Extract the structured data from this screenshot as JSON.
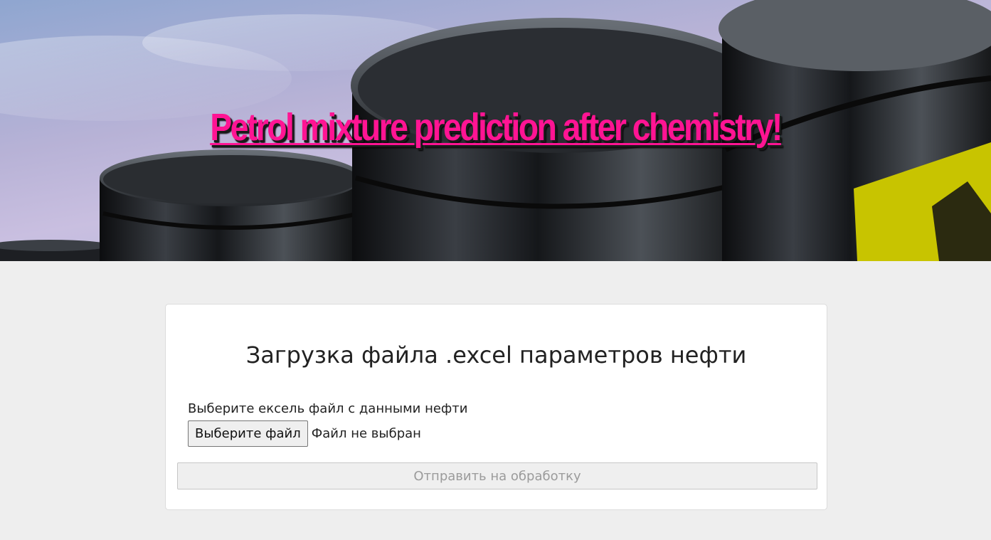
{
  "hero": {
    "title": "Petrol mixture prediction after chemistry!",
    "title_color": "#ff1493"
  },
  "upload": {
    "heading": "Загрузка файла .excel параметров нефти",
    "field_label": "Выберите ексель файл с данными нефти",
    "choose_button": "Выберите файл",
    "file_status": "Файл не выбран",
    "submit_button": "Отправить на обработку",
    "submit_disabled": true
  }
}
